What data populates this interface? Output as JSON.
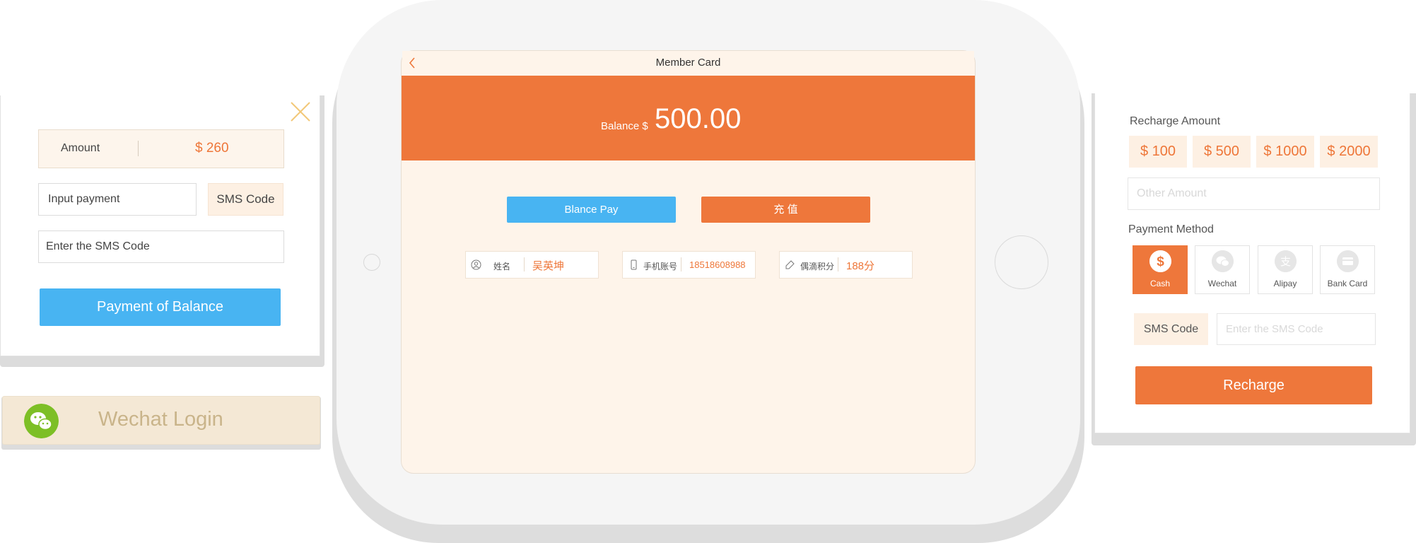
{
  "payment_card": {
    "amount_label": "Amount",
    "amount_value": "$ 260",
    "input_payment_placeholder": "Input payment",
    "sms_code_button": "SMS Code",
    "sms_code_placeholder": "Enter the SMS Code",
    "pay_button": "Payment of Balance"
  },
  "wechat_login": {
    "label": "Wechat Login"
  },
  "ipad": {
    "title": "Member Card",
    "balance_label": "Balance $",
    "balance_value": "500.00",
    "blance_pay_button": "Blance Pay",
    "recharge_button": "充 值",
    "info": [
      {
        "label": "姓名",
        "value": "吴英坤",
        "icon": "user-icon"
      },
      {
        "label": "手机账号",
        "value": "18518608988",
        "icon": "phone-icon"
      },
      {
        "label": "偶滴积分",
        "value": "188分",
        "icon": "points-icon"
      }
    ]
  },
  "recharge_card": {
    "title": "Recharge Amount",
    "amounts": [
      "$ 100",
      "$ 500",
      "$ 1000",
      "$ 2000"
    ],
    "other_amount_placeholder": "Other Amount",
    "payment_method_title": "Payment Method",
    "methods": [
      {
        "label": "Cash",
        "icon": "dollar-icon",
        "active": true
      },
      {
        "label": "Wechat",
        "icon": "wechat-icon",
        "active": false
      },
      {
        "label": "Alipay",
        "icon": "alipay-icon",
        "active": false
      },
      {
        "label": "Bank Card",
        "icon": "bank-card-icon",
        "active": false
      }
    ],
    "sms_code_button": "SMS Code",
    "sms_code_placeholder": "Enter the SMS Code",
    "recharge_button": "Recharge"
  },
  "colors": {
    "accent_orange": "#ee773b",
    "accent_blue": "#48b4f2",
    "cream": "#fef4ea",
    "wechat_green": "#7dbf26"
  }
}
